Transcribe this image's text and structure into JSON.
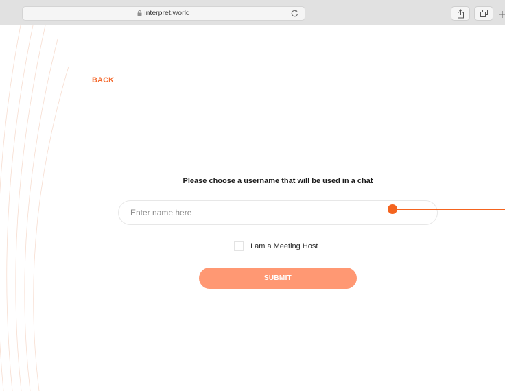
{
  "browser": {
    "url": "interpret.world",
    "share_icon": "share-icon",
    "tabs_icon": "tabs-icon",
    "new_tab_icon": "plus-icon"
  },
  "page": {
    "back_label": "BACK",
    "prompt": "Please choose a username that will be used in a chat",
    "name_input": {
      "value": "",
      "placeholder": "Enter name here"
    },
    "host_checkbox": {
      "label": "I am a Meeting Host",
      "checked": false
    },
    "submit_label": "SUBMIT"
  },
  "colors": {
    "accent": "#f46a2e",
    "button": "#ff9873",
    "pointer": "#f4641f"
  }
}
